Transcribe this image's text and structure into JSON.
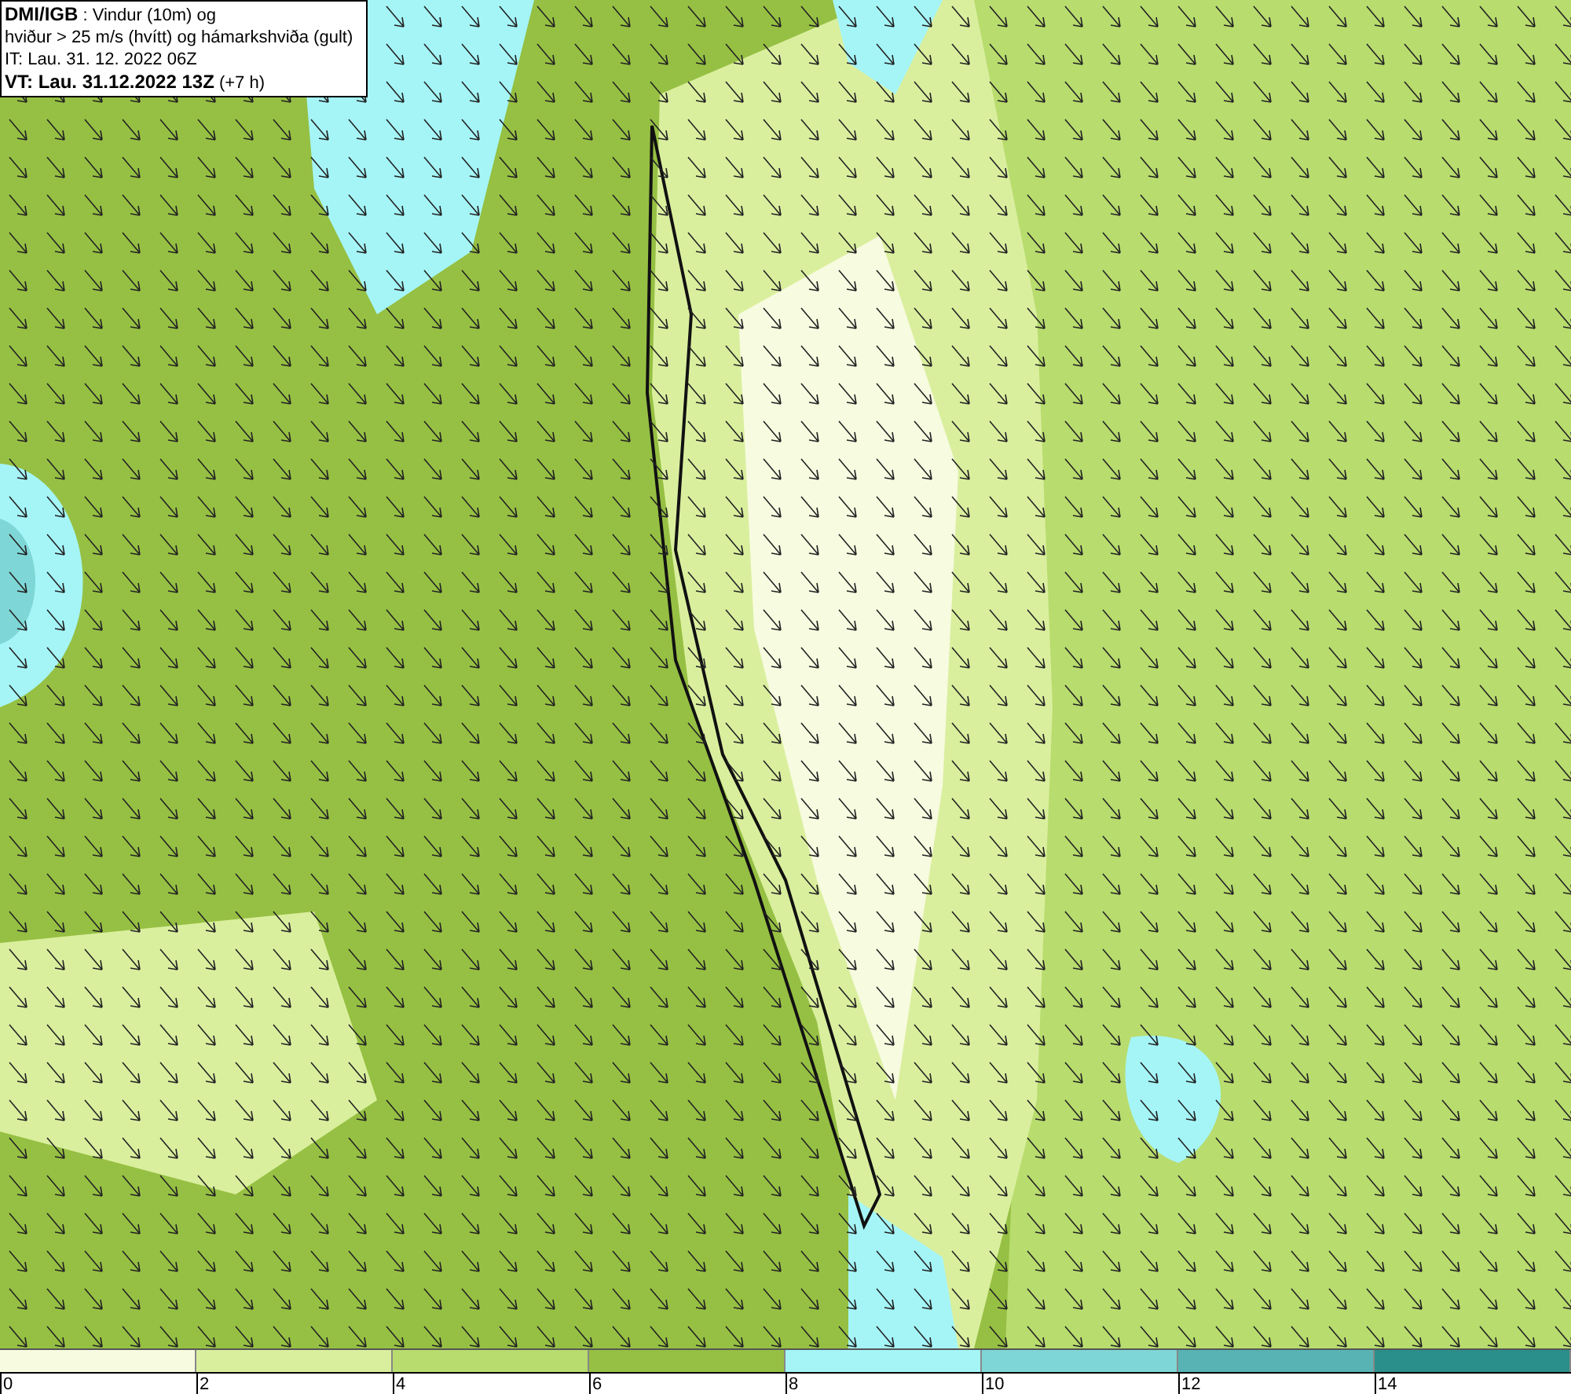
{
  "title_box": {
    "lines": [
      "**DMI/IGB** : Vindur (10m) og",
      "hviður > 25 m/s (hvítt) og hámarkshviða (gult)",
      "IT: Lau. 31. 12. 2022 06Z",
      "**VT: Lau. 31.12.2022 13Z** (+7 h)"
    ]
  },
  "legend": {
    "bins": [
      {
        "color": "#f7fbe0",
        "label": "0"
      },
      {
        "color": "#daef9e",
        "label": "2"
      },
      {
        "color": "#b8dc6e",
        "label": "4"
      },
      {
        "color": "#96c043",
        "label": "6"
      },
      {
        "color": "#a5f5f7",
        "label": "8"
      },
      {
        "color": "#7fd6d6",
        "label": "10"
      },
      {
        "color": "#58b4b4",
        "label": "12"
      },
      {
        "color": "#2a8f8a",
        "label": "14"
      }
    ]
  }
}
